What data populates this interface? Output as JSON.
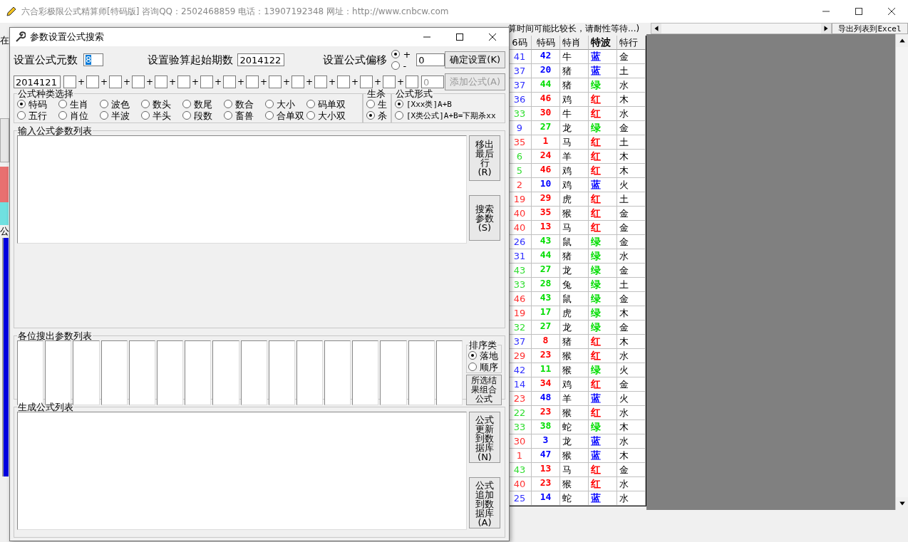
{
  "main_window": {
    "title": "六合彩极限公式精算师[特码版]  咨询QQ：2502468859 电话：13907192348 网址：http://www.cnbcw.com",
    "status_text": "算时间可能比较长，请耐性等待...)",
    "export_button": "导出列表到Excel",
    "left_labels": [
      "在",
      "公"
    ]
  },
  "table": {
    "columns": [
      "6码",
      "特码",
      "特肖",
      "特波",
      "特行"
    ],
    "rows": [
      {
        "pos6": {
          "text": "41",
          "color": "#3030ff"
        },
        "code": {
          "text": "42",
          "color": "#0000ff"
        },
        "zodiac": "牛",
        "wave": {
          "text": "蓝",
          "color": "#0000ff"
        },
        "element": "金"
      },
      {
        "pos6": {
          "text": "37",
          "color": "#3030ff"
        },
        "code": {
          "text": "20",
          "color": "#0000ff"
        },
        "zodiac": "猪",
        "wave": {
          "text": "蓝",
          "color": "#0000ff"
        },
        "element": "土"
      },
      {
        "pos6": {
          "text": "37",
          "color": "#3030ff"
        },
        "code": {
          "text": "44",
          "color": "#00dd00"
        },
        "zodiac": "猪",
        "wave": {
          "text": "绿",
          "color": "#00dd00"
        },
        "element": "水"
      },
      {
        "pos6": {
          "text": "36",
          "color": "#3030ff"
        },
        "code": {
          "text": "46",
          "color": "#ff0000"
        },
        "zodiac": "鸡",
        "wave": {
          "text": "红",
          "color": "#ff0000"
        },
        "element": "木"
      },
      {
        "pos6": {
          "text": "33",
          "color": "#30dd30"
        },
        "code": {
          "text": "30",
          "color": "#ff0000"
        },
        "zodiac": "牛",
        "wave": {
          "text": "红",
          "color": "#ff0000"
        },
        "element": "水"
      },
      {
        "pos6": {
          "text": "9",
          "color": "#3030ff"
        },
        "code": {
          "text": "27",
          "color": "#00dd00"
        },
        "zodiac": "龙",
        "wave": {
          "text": "绿",
          "color": "#00dd00"
        },
        "element": "金"
      },
      {
        "pos6": {
          "text": "35",
          "color": "#ff3030"
        },
        "code": {
          "text": "1",
          "color": "#ff0000"
        },
        "zodiac": "马",
        "wave": {
          "text": "红",
          "color": "#ff0000"
        },
        "element": "土"
      },
      {
        "pos6": {
          "text": "6",
          "color": "#30dd30"
        },
        "code": {
          "text": "24",
          "color": "#ff0000"
        },
        "zodiac": "羊",
        "wave": {
          "text": "红",
          "color": "#ff0000"
        },
        "element": "木"
      },
      {
        "pos6": {
          "text": "5",
          "color": "#30dd30"
        },
        "code": {
          "text": "46",
          "color": "#ff0000"
        },
        "zodiac": "鸡",
        "wave": {
          "text": "红",
          "color": "#ff0000"
        },
        "element": "木"
      },
      {
        "pos6": {
          "text": "2",
          "color": "#ff3030"
        },
        "code": {
          "text": "10",
          "color": "#0000ff"
        },
        "zodiac": "鸡",
        "wave": {
          "text": "蓝",
          "color": "#0000ff"
        },
        "element": "火"
      },
      {
        "pos6": {
          "text": "19",
          "color": "#ff3030"
        },
        "code": {
          "text": "29",
          "color": "#ff0000"
        },
        "zodiac": "虎",
        "wave": {
          "text": "红",
          "color": "#ff0000"
        },
        "element": "土"
      },
      {
        "pos6": {
          "text": "40",
          "color": "#ff3030"
        },
        "code": {
          "text": "35",
          "color": "#ff0000"
        },
        "zodiac": "猴",
        "wave": {
          "text": "红",
          "color": "#ff0000"
        },
        "element": "金"
      },
      {
        "pos6": {
          "text": "40",
          "color": "#ff3030"
        },
        "code": {
          "text": "13",
          "color": "#ff0000"
        },
        "zodiac": "马",
        "wave": {
          "text": "红",
          "color": "#ff0000"
        },
        "element": "金"
      },
      {
        "pos6": {
          "text": "26",
          "color": "#3030ff"
        },
        "code": {
          "text": "43",
          "color": "#00dd00"
        },
        "zodiac": "鼠",
        "wave": {
          "text": "绿",
          "color": "#00dd00"
        },
        "element": "金"
      },
      {
        "pos6": {
          "text": "31",
          "color": "#3030ff"
        },
        "code": {
          "text": "44",
          "color": "#00dd00"
        },
        "zodiac": "猪",
        "wave": {
          "text": "绿",
          "color": "#00dd00"
        },
        "element": "水"
      },
      {
        "pos6": {
          "text": "43",
          "color": "#30dd30"
        },
        "code": {
          "text": "27",
          "color": "#00dd00"
        },
        "zodiac": "龙",
        "wave": {
          "text": "绿",
          "color": "#00dd00"
        },
        "element": "金"
      },
      {
        "pos6": {
          "text": "33",
          "color": "#30dd30"
        },
        "code": {
          "text": "28",
          "color": "#00dd00"
        },
        "zodiac": "兔",
        "wave": {
          "text": "绿",
          "color": "#00dd00"
        },
        "element": "土"
      },
      {
        "pos6": {
          "text": "46",
          "color": "#ff3030"
        },
        "code": {
          "text": "43",
          "color": "#00dd00"
        },
        "zodiac": "鼠",
        "wave": {
          "text": "绿",
          "color": "#00dd00"
        },
        "element": "金"
      },
      {
        "pos6": {
          "text": "19",
          "color": "#ff3030"
        },
        "code": {
          "text": "17",
          "color": "#00dd00"
        },
        "zodiac": "虎",
        "wave": {
          "text": "绿",
          "color": "#00dd00"
        },
        "element": "木"
      },
      {
        "pos6": {
          "text": "32",
          "color": "#30dd30"
        },
        "code": {
          "text": "27",
          "color": "#00dd00"
        },
        "zodiac": "龙",
        "wave": {
          "text": "绿",
          "color": "#00dd00"
        },
        "element": "金"
      },
      {
        "pos6": {
          "text": "37",
          "color": "#3030ff"
        },
        "code": {
          "text": "8",
          "color": "#ff0000"
        },
        "zodiac": "猪",
        "wave": {
          "text": "红",
          "color": "#ff0000"
        },
        "element": "木"
      },
      {
        "pos6": {
          "text": "29",
          "color": "#ff3030"
        },
        "code": {
          "text": "23",
          "color": "#ff0000"
        },
        "zodiac": "猴",
        "wave": {
          "text": "红",
          "color": "#ff0000"
        },
        "element": "水"
      },
      {
        "pos6": {
          "text": "42",
          "color": "#3030ff"
        },
        "code": {
          "text": "11",
          "color": "#00dd00"
        },
        "zodiac": "猴",
        "wave": {
          "text": "绿",
          "color": "#00dd00"
        },
        "element": "火"
      },
      {
        "pos6": {
          "text": "14",
          "color": "#3030ff"
        },
        "code": {
          "text": "34",
          "color": "#ff0000"
        },
        "zodiac": "鸡",
        "wave": {
          "text": "红",
          "color": "#ff0000"
        },
        "element": "金"
      },
      {
        "pos6": {
          "text": "23",
          "color": "#ff3030"
        },
        "code": {
          "text": "48",
          "color": "#0000ff"
        },
        "zodiac": "羊",
        "wave": {
          "text": "蓝",
          "color": "#0000ff"
        },
        "element": "火"
      },
      {
        "pos6": {
          "text": "22",
          "color": "#30dd30"
        },
        "code": {
          "text": "23",
          "color": "#ff0000"
        },
        "zodiac": "猴",
        "wave": {
          "text": "红",
          "color": "#ff0000"
        },
        "element": "水"
      },
      {
        "pos6": {
          "text": "33",
          "color": "#30dd30"
        },
        "code": {
          "text": "38",
          "color": "#00dd00"
        },
        "zodiac": "蛇",
        "wave": {
          "text": "绿",
          "color": "#00dd00"
        },
        "element": "木"
      },
      {
        "pos6": {
          "text": "30",
          "color": "#ff3030"
        },
        "code": {
          "text": "3",
          "color": "#0000ff"
        },
        "zodiac": "龙",
        "wave": {
          "text": "蓝",
          "color": "#0000ff"
        },
        "element": "水"
      },
      {
        "pos6": {
          "text": "1",
          "color": "#ff3030"
        },
        "code": {
          "text": "47",
          "color": "#0000ff"
        },
        "zodiac": "猴",
        "wave": {
          "text": "蓝",
          "color": "#0000ff"
        },
        "element": "木"
      },
      {
        "pos6": {
          "text": "43",
          "color": "#30dd30"
        },
        "code": {
          "text": "13",
          "color": "#ff0000"
        },
        "zodiac": "马",
        "wave": {
          "text": "红",
          "color": "#ff0000"
        },
        "element": "金"
      },
      {
        "pos6": {
          "text": "40",
          "color": "#ff3030"
        },
        "code": {
          "text": "23",
          "color": "#ff0000"
        },
        "zodiac": "猴",
        "wave": {
          "text": "红",
          "color": "#ff0000"
        },
        "element": "水"
      },
      {
        "pos6": {
          "text": "25",
          "color": "#3030ff"
        },
        "code": {
          "text": "14",
          "color": "#0000ff"
        },
        "zodiac": "蛇",
        "wave": {
          "text": "蓝",
          "color": "#0000ff"
        },
        "element": "水"
      }
    ]
  },
  "dialog": {
    "title": "参数设置公式搜索",
    "element_count": {
      "label": "设置公式元数",
      "value": "8"
    },
    "start_period": {
      "label": "设置验算起始期数",
      "value": "2014122"
    },
    "offset": {
      "label": "设置公式偏移",
      "options": [
        {
          "label": "+",
          "selected": true
        },
        {
          "label": "-",
          "selected": false
        }
      ],
      "value": "0"
    },
    "confirm_button": "确定设置(K)",
    "param_row": {
      "first": "2014121",
      "boxes": [
        {
          "kind": "blank"
        },
        {
          "joiner": "+"
        },
        {
          "joiner": "+"
        },
        {
          "joiner": "+"
        },
        {
          "joiner": "+"
        },
        {
          "joiner": "+"
        },
        {
          "joiner": "+"
        },
        {
          "joiner": "+"
        },
        {
          "joiner": "+"
        },
        {
          "joiner": "+"
        },
        {
          "joiner": "+"
        },
        {
          "joiner": "+"
        },
        {
          "joiner": "+"
        },
        {
          "joiner": "+"
        },
        {
          "joiner": "+"
        },
        {
          "joiner": "+"
        }
      ],
      "last": "0"
    },
    "add_button": {
      "label": "添加公式(A)",
      "disabled": true
    },
    "type_group": {
      "title": "公式种类选择",
      "options": [
        {
          "label": "特码",
          "selected": true
        },
        {
          "label": "生肖",
          "selected": false
        },
        {
          "label": "波色",
          "selected": false
        },
        {
          "label": "数头",
          "selected": false
        },
        {
          "label": "数尾",
          "selected": false
        },
        {
          "label": "数合",
          "selected": false
        },
        {
          "label": "大小",
          "selected": false
        },
        {
          "label": "码单双",
          "selected": false
        },
        {
          "label": "五行",
          "selected": false
        },
        {
          "label": "肖位",
          "selected": false
        },
        {
          "label": "半波",
          "selected": false
        },
        {
          "label": "半头",
          "selected": false
        },
        {
          "label": "段数",
          "selected": false
        },
        {
          "label": "畜兽",
          "selected": false
        },
        {
          "label": "合单双",
          "selected": false
        },
        {
          "label": "大小双",
          "selected": false
        }
      ]
    },
    "life_group": {
      "title": "生杀",
      "options": [
        {
          "label": "生",
          "selected": false
        },
        {
          "label": "杀",
          "selected": true
        }
      ]
    },
    "form_group": {
      "title": "公式形式",
      "options": [
        {
          "label": "[Xxx类]A+B",
          "selected": true
        },
        {
          "label": "[X类公式]A+B=下期杀xx",
          "selected": false
        }
      ]
    },
    "input_group": {
      "title": "输入公式参数列表",
      "buttons": [
        "移出最后行(R)",
        "搜索参数(S)"
      ]
    },
    "result_group": {
      "title": "各位搜出参数列表"
    },
    "sort_group": {
      "title": "排序类",
      "options": [
        {
          "label": "落地",
          "selected": true
        },
        {
          "label": "顺序",
          "selected": false
        }
      ]
    },
    "combine_button": "所选结果组合公式",
    "generate_group": {
      "title": "生成公式列表",
      "buttons": [
        "公式更新到数据库(N)",
        "公式追加到数据库(A)"
      ]
    }
  }
}
